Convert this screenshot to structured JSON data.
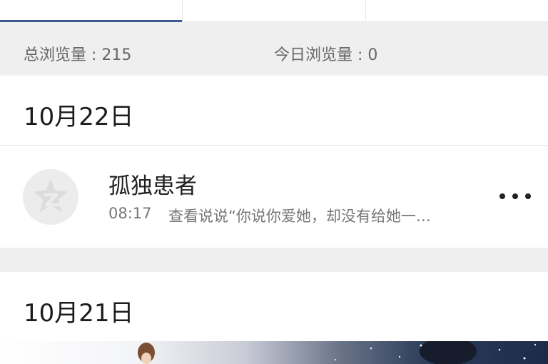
{
  "tabs": [
    {
      "label": "",
      "active": true
    },
    {
      "label": "",
      "active": false
    },
    {
      "label": "",
      "active": false
    }
  ],
  "stats": {
    "total_views": "总浏览量 : 215",
    "today_views": "今日浏览量 : 0"
  },
  "sections": [
    {
      "date": "10月22日",
      "items": [
        {
          "name": "孤独患者",
          "time": "08:17",
          "action": "查看说说“你说你爱她，却没有给她一…",
          "more_icon": "more-dots-icon",
          "avatar_icon": "qzone-star-icon"
        }
      ]
    },
    {
      "date": "10月21日",
      "items": []
    }
  ],
  "colors": {
    "active_tab_underline": "#3a5a8e",
    "stats_background": "#efefef"
  }
}
